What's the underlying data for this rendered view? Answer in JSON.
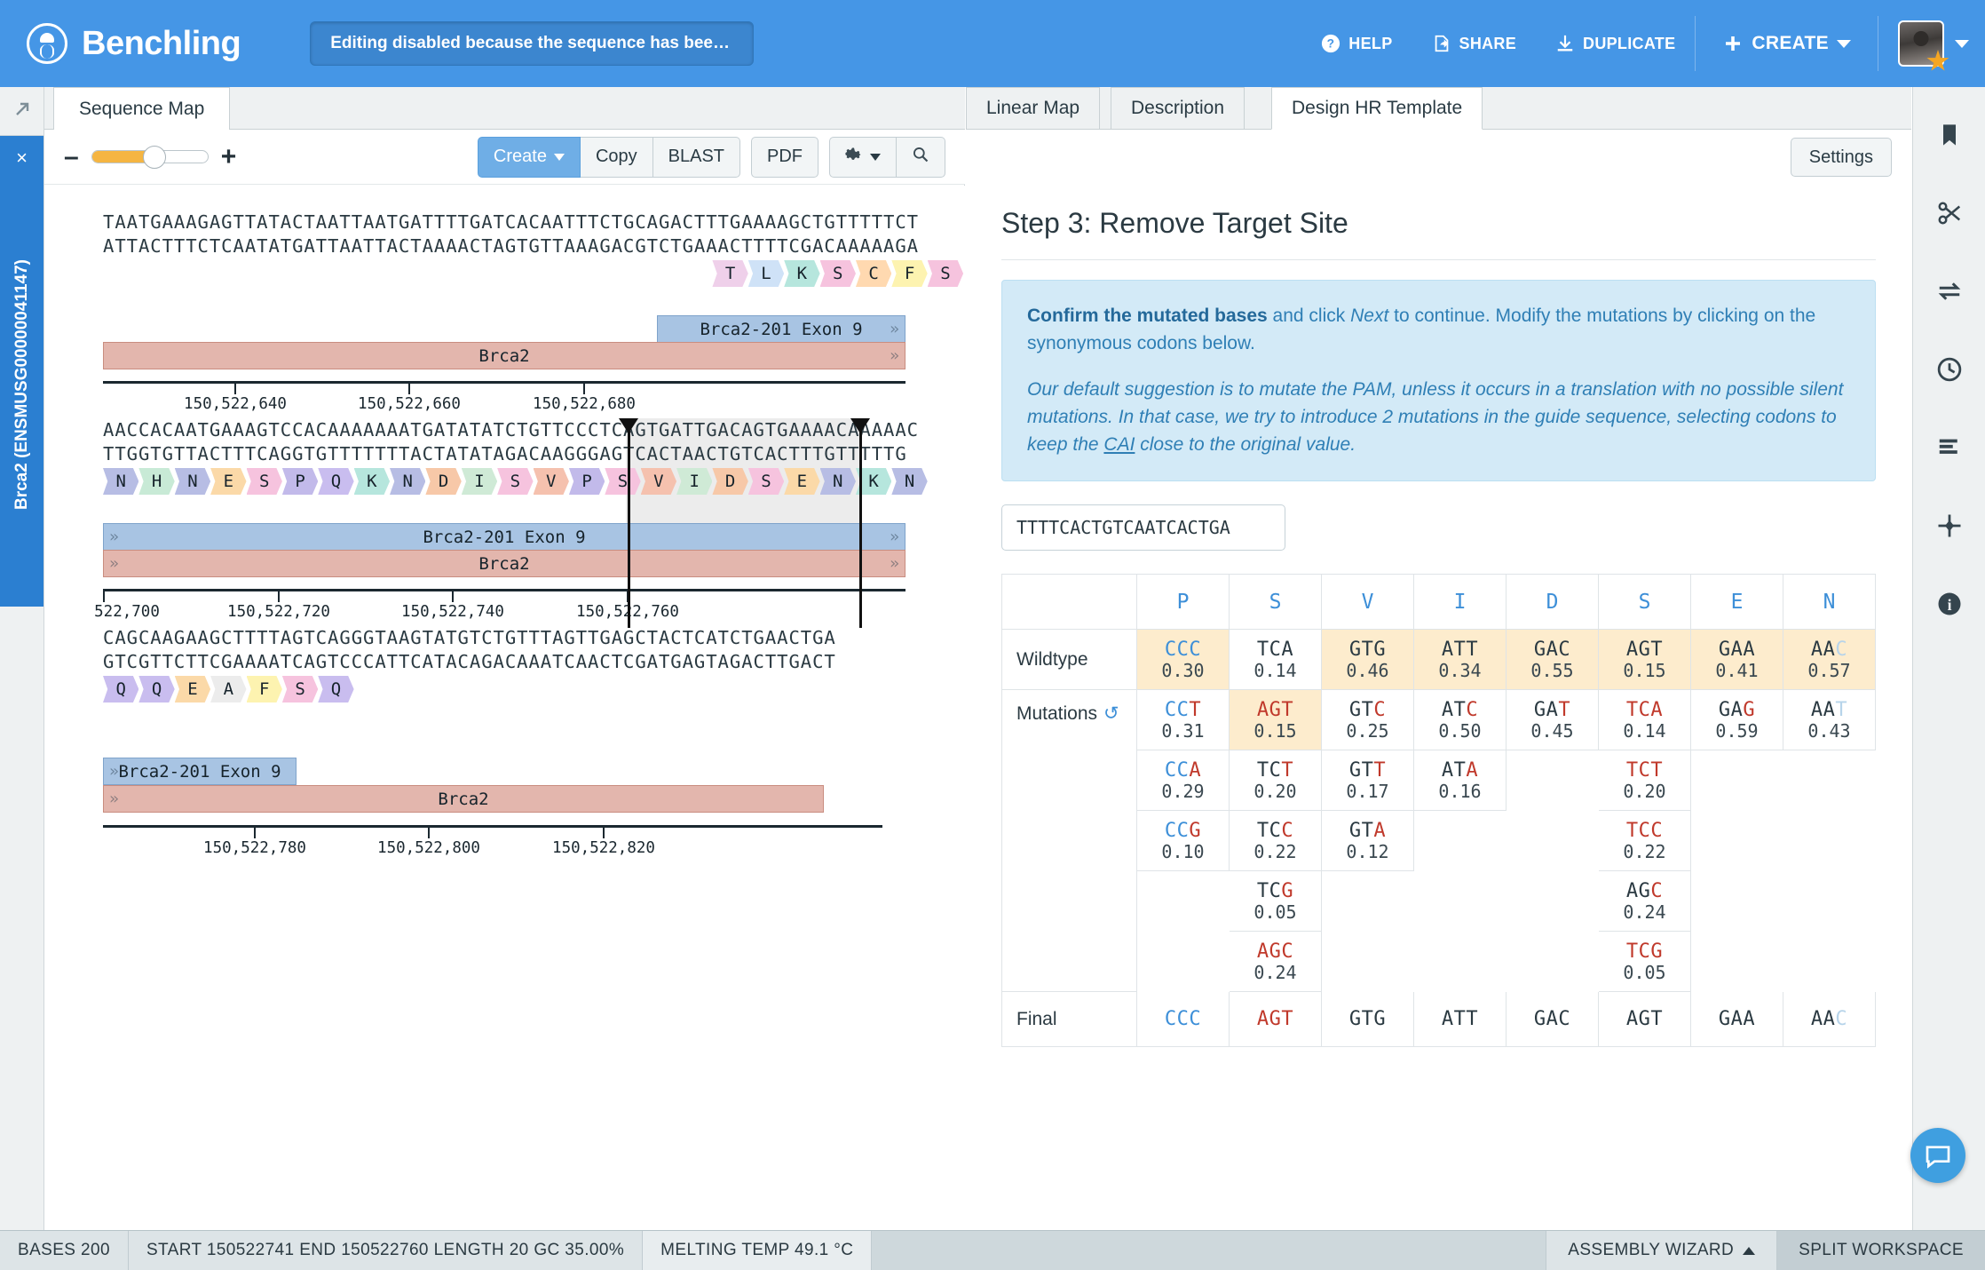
{
  "topbar": {
    "brand": "Benchling",
    "locked_banner": "Editing disabled because the sequence has been locke...",
    "actions": [
      {
        "label": "HELP",
        "icon": "question-circle-icon"
      },
      {
        "label": "SHARE",
        "icon": "share-icon"
      },
      {
        "label": "DUPLICATE",
        "icon": "download-icon"
      }
    ],
    "create_label": "CREATE"
  },
  "left_rail": {
    "close_label": "×",
    "project_label": "Brca2 (ENSMUSG00000041147)"
  },
  "left_pane": {
    "tab_label": "Sequence Map",
    "toolbar": {
      "create": "Create",
      "copy": "Copy",
      "blast": "BLAST",
      "pdf": "PDF",
      "gear_icon": "gear-icon",
      "search_icon": "search-icon"
    },
    "blocks": [
      {
        "top": "TAATGAAAGAGTTATACTAATTAATGATTTTGATCACAATTTCTGCAGACTTTGAAAAGCTGTTTTTCT",
        "bottom": "ATTACTTTCTCAATATGATTAATTACTAAAACTAGTGTTAAAGACGTCTGAAACTTTTCGACAAAAAGA",
        "aa_start_index": 51,
        "aa": [
          "T",
          "L",
          "K",
          "S",
          "C",
          "F",
          "S"
        ],
        "exon_label": "Brca2-201 Exon 9",
        "gene_label": "Brca2",
        "ruler": [
          "150,522,640",
          "150,522,660",
          "150,522,680"
        ]
      },
      {
        "top": "AACCACAATGAAAGTCCACAAAAAAATGATATATCTGTTCCCTCAGTGATTGACAGTGAAAACAAAAAC",
        "bottom": "TTGGTGTTACTTTCAGGTGTTTTTTTACTATATAGACAAGGGAGTCACTAACTGTCACTTTGTTTTTG",
        "aa_start_index": 0,
        "aa": [
          "N",
          "H",
          "N",
          "E",
          "S",
          "P",
          "Q",
          "K",
          "N",
          "D",
          "I",
          "S",
          "V",
          "P",
          "S",
          "V",
          "I",
          "D",
          "S",
          "E",
          "N",
          "K",
          "N"
        ],
        "exon_label": "Brca2-201 Exon 9",
        "gene_label": "Brca2",
        "ruler": [
          "522,700",
          "150,522,720",
          "150,522,740",
          "150,522,760"
        ]
      },
      {
        "top": "CAGCAAGAAGCTTTTAGTCAGGGTAAGTATGTCTGTTTAGTTGAGCTACTCATCTGAACTGA",
        "bottom": "GTCGTTCTTCGAAAATCAGTCCCATTCATACAGACAAATCAACTCGATGAGTAGACTTGACT",
        "aa_start_index": 0,
        "aa": [
          "Q",
          "Q",
          "E",
          "A",
          "F",
          "S",
          "Q"
        ],
        "exon_label": "Brca2-201 Exon 9",
        "gene_label": "Brca2",
        "ruler": [
          "150,522,780",
          "150,522,800",
          "150,522,820"
        ]
      }
    ]
  },
  "right_pane": {
    "tabs": [
      {
        "label": "Linear Map",
        "active": false
      },
      {
        "label": "Description",
        "active": false
      },
      {
        "label": "Design HR Template",
        "active": true
      }
    ],
    "settings_label": "Settings",
    "step_title": "Step 3: Remove Target Site",
    "info": {
      "p1_bold": "Confirm the mutated bases",
      "p1_mid": " and click ",
      "p1_italic": "Next",
      "p1_rest": " to continue. Modify the mutations by clicking on the synonymous codons below.",
      "p2_a": "Our default suggestion is to mutate the PAM, unless it occurs in a translation with no possible silent mutations. In that case, we try to introduce 2 mutations in the guide sequence, selecting codons to keep the ",
      "p2_link": "CAI",
      "p2_b": " close to the original value."
    },
    "guide_sequence": "TTTTCACTGTCAATCACTGA",
    "table": {
      "row_labels": {
        "wildtype": "Wildtype",
        "mutations": "Mutations",
        "final": "Final",
        "reset_icon": "reset-icon"
      },
      "amino_acids": [
        "P",
        "S",
        "V",
        "I",
        "D",
        "S",
        "E",
        "N"
      ],
      "wildtype": [
        {
          "codon": "CCC",
          "freq": "0.30",
          "hl": true,
          "colors": [
            "b",
            "b",
            "b"
          ]
        },
        {
          "codon": "TCA",
          "freq": "0.14",
          "hl": false,
          "colors": [
            "k",
            "k",
            "k"
          ]
        },
        {
          "codon": "GTG",
          "freq": "0.46",
          "hl": true,
          "colors": [
            "k",
            "k",
            "k"
          ]
        },
        {
          "codon": "ATT",
          "freq": "0.34",
          "hl": true,
          "colors": [
            "k",
            "k",
            "k"
          ]
        },
        {
          "codon": "GAC",
          "freq": "0.55",
          "hl": true,
          "colors": [
            "k",
            "k",
            "k"
          ]
        },
        {
          "codon": "AGT",
          "freq": "0.15",
          "hl": true,
          "colors": [
            "k",
            "k",
            "k"
          ]
        },
        {
          "codon": "GAA",
          "freq": "0.41",
          "hl": true,
          "colors": [
            "k",
            "k",
            "k"
          ]
        },
        {
          "codon": "AAC",
          "freq": "0.57",
          "hl": true,
          "colors": [
            "k",
            "k",
            "lb"
          ]
        }
      ],
      "mutations": [
        [
          {
            "codon": "CCT",
            "freq": "0.31",
            "hl": false,
            "colors": [
              "b",
              "b",
              "r"
            ]
          },
          {
            "codon": "AGT",
            "freq": "0.15",
            "hl": true,
            "colors": [
              "r",
              "r",
              "r"
            ]
          },
          {
            "codon": "GTC",
            "freq": "0.25",
            "hl": false,
            "colors": [
              "k",
              "k",
              "r"
            ]
          },
          {
            "codon": "ATC",
            "freq": "0.50",
            "hl": false,
            "colors": [
              "k",
              "k",
              "r"
            ]
          },
          {
            "codon": "GAT",
            "freq": "0.45",
            "hl": false,
            "colors": [
              "k",
              "k",
              "r"
            ]
          },
          {
            "codon": "TCA",
            "freq": "0.14",
            "hl": false,
            "colors": [
              "r",
              "r",
              "r"
            ]
          },
          {
            "codon": "GAG",
            "freq": "0.59",
            "hl": false,
            "colors": [
              "k",
              "k",
              "r"
            ]
          },
          {
            "codon": "AAT",
            "freq": "0.43",
            "hl": false,
            "colors": [
              "k",
              "k",
              "lb"
            ]
          }
        ],
        [
          {
            "codon": "CCA",
            "freq": "0.29",
            "hl": false,
            "colors": [
              "b",
              "b",
              "r"
            ]
          },
          {
            "codon": "TCT",
            "freq": "0.20",
            "hl": false,
            "colors": [
              "k",
              "k",
              "r"
            ]
          },
          {
            "codon": "GTT",
            "freq": "0.17",
            "hl": false,
            "colors": [
              "k",
              "k",
              "r"
            ]
          },
          {
            "codon": "ATA",
            "freq": "0.16",
            "hl": false,
            "colors": [
              "k",
              "k",
              "r"
            ]
          },
          {
            "codon": "",
            "freq": "",
            "hl": false,
            "colors": []
          },
          {
            "codon": "TCT",
            "freq": "0.20",
            "hl": false,
            "colors": [
              "r",
              "r",
              "r"
            ]
          },
          {
            "codon": "",
            "freq": "",
            "hl": false,
            "colors": []
          },
          {
            "codon": "",
            "freq": "",
            "hl": false,
            "colors": []
          }
        ],
        [
          {
            "codon": "CCG",
            "freq": "0.10",
            "hl": false,
            "colors": [
              "b",
              "b",
              "r"
            ]
          },
          {
            "codon": "TCC",
            "freq": "0.22",
            "hl": false,
            "colors": [
              "k",
              "k",
              "r"
            ]
          },
          {
            "codon": "GTA",
            "freq": "0.12",
            "hl": false,
            "colors": [
              "k",
              "k",
              "r"
            ]
          },
          {
            "codon": "",
            "freq": "",
            "hl": false,
            "colors": []
          },
          {
            "codon": "",
            "freq": "",
            "hl": false,
            "colors": []
          },
          {
            "codon": "TCC",
            "freq": "0.22",
            "hl": false,
            "colors": [
              "r",
              "r",
              "r"
            ]
          },
          {
            "codon": "",
            "freq": "",
            "hl": false,
            "colors": []
          },
          {
            "codon": "",
            "freq": "",
            "hl": false,
            "colors": []
          }
        ],
        [
          {
            "codon": "",
            "freq": "",
            "hl": false,
            "colors": []
          },
          {
            "codon": "TCG",
            "freq": "0.05",
            "hl": false,
            "colors": [
              "k",
              "k",
              "r"
            ]
          },
          {
            "codon": "",
            "freq": "",
            "hl": false,
            "colors": []
          },
          {
            "codon": "",
            "freq": "",
            "hl": false,
            "colors": []
          },
          {
            "codon": "",
            "freq": "",
            "hl": false,
            "colors": []
          },
          {
            "codon": "AGC",
            "freq": "0.24",
            "hl": false,
            "colors": [
              "k",
              "k",
              "r"
            ]
          },
          {
            "codon": "",
            "freq": "",
            "hl": false,
            "colors": []
          },
          {
            "codon": "",
            "freq": "",
            "hl": false,
            "colors": []
          }
        ],
        [
          {
            "codon": "",
            "freq": "",
            "hl": false,
            "colors": []
          },
          {
            "codon": "AGC",
            "freq": "0.24",
            "hl": false,
            "colors": [
              "r",
              "r",
              "r"
            ]
          },
          {
            "codon": "",
            "freq": "",
            "hl": false,
            "colors": []
          },
          {
            "codon": "",
            "freq": "",
            "hl": false,
            "colors": []
          },
          {
            "codon": "",
            "freq": "",
            "hl": false,
            "colors": []
          },
          {
            "codon": "TCG",
            "freq": "0.05",
            "hl": false,
            "colors": [
              "r",
              "r",
              "r"
            ]
          },
          {
            "codon": "",
            "freq": "",
            "hl": false,
            "colors": []
          },
          {
            "codon": "",
            "freq": "",
            "hl": false,
            "colors": []
          }
        ]
      ],
      "final": [
        {
          "codon": "CCC",
          "colors": [
            "b",
            "b",
            "b"
          ]
        },
        {
          "codon": "AGT",
          "colors": [
            "r",
            "r",
            "r"
          ]
        },
        {
          "codon": "GTG",
          "colors": [
            "k",
            "k",
            "k"
          ]
        },
        {
          "codon": "ATT",
          "colors": [
            "k",
            "k",
            "k"
          ]
        },
        {
          "codon": "GAC",
          "colors": [
            "k",
            "k",
            "k"
          ]
        },
        {
          "codon": "AGT",
          "colors": [
            "k",
            "k",
            "k"
          ]
        },
        {
          "codon": "GAA",
          "colors": [
            "k",
            "k",
            "k"
          ]
        },
        {
          "codon": "AAC",
          "colors": [
            "k",
            "k",
            "lb"
          ]
        }
      ]
    }
  },
  "icon_rail": [
    {
      "icon": "bookmark-icon"
    },
    {
      "icon": "scissors-icon"
    },
    {
      "icon": "swap-arrows-icon"
    },
    {
      "icon": "clock-icon"
    },
    {
      "icon": "align-left-icon"
    },
    {
      "icon": "crosshair-icon"
    },
    {
      "icon": "info-circle-icon"
    }
  ],
  "chat": {
    "icon": "chat-bubble-icon"
  },
  "statusbar": {
    "bases": "BASES  200",
    "metrics": "START 150522741   END 150522760   LENGTH 20   GC 35.00%",
    "melting": "MELTING TEMP 49.1 °C",
    "assembly_wizard": "ASSEMBLY WIZARD",
    "split_workspace": "SPLIT WORKSPACE"
  }
}
